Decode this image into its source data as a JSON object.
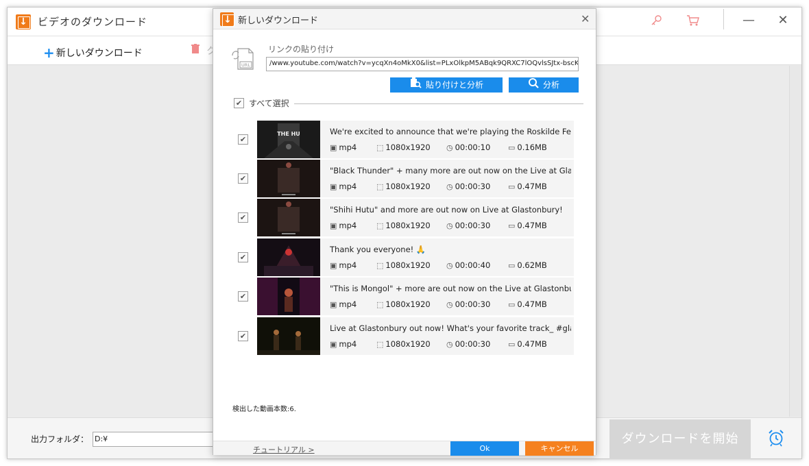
{
  "main_window": {
    "title": "ビデオのダウンロード",
    "toolbar": {
      "new_download_label": "新しいダウンロード",
      "delete_label_partial": "ク"
    },
    "output_folder_label": "出力フォルダ：",
    "output_folder_value": "D:¥",
    "start_download_label": "ダウンロードを開始",
    "title_icons": [
      "key-icon",
      "cart-icon",
      "minimize-icon",
      "close-icon"
    ]
  },
  "dialog": {
    "title": "新しいダウンロード",
    "paste_label": "リンクの貼り付け",
    "url_value": "/www.youtube.com/watch?v=ycqXn4oMkX0&list=PLxOlkpM5ABqk9QRXC7lOQvlsSJtx-bscK",
    "paste_analyze_label": "貼り付けと分析",
    "analyze_label": "分析",
    "select_all_label": "すべて選択",
    "videos": [
      {
        "title": "We're excited to announce that we're playing the Roskilde Festival ...",
        "format": "mp4",
        "resolution": "1080x1920",
        "duration": "00:00:10",
        "size": "0.16MB",
        "checked": true
      },
      {
        "title": "\"Black Thunder\" + many more are out now on the Live at Glastonb...",
        "format": "mp4",
        "resolution": "1080x1920",
        "duration": "00:00:30",
        "size": "0.47MB",
        "checked": true
      },
      {
        "title": "\"Shihi Hutu\" and more are out now on Live at Glastonbury!",
        "format": "mp4",
        "resolution": "1080x1920",
        "duration": "00:00:30",
        "size": "0.47MB",
        "checked": true
      },
      {
        "title": "Thank you everyone! 🙏",
        "format": "mp4",
        "resolution": "1080x1920",
        "duration": "00:00:40",
        "size": "0.62MB",
        "checked": true
      },
      {
        "title": "\"This is Mongol\" + more are out now on the Live at Glastonbury alb...",
        "format": "mp4",
        "resolution": "1080x1920",
        "duration": "00:00:30",
        "size": "0.47MB",
        "checked": true
      },
      {
        "title": "Live at Glastonbury out now! What's your favorite track_ #glastonb...",
        "format": "mp4",
        "resolution": "1080x1920",
        "duration": "00:00:30",
        "size": "0.47MB",
        "checked": true
      }
    ],
    "found_count_label": "検出した動画本数:6.",
    "tutorial_label": "チュートリアル >",
    "ok_label": "Ok",
    "cancel_label": "キャンセル"
  },
  "colors": {
    "accent_blue": "#1a8ceb",
    "accent_orange": "#f5811f",
    "logo_orange": "#f07b1a"
  }
}
